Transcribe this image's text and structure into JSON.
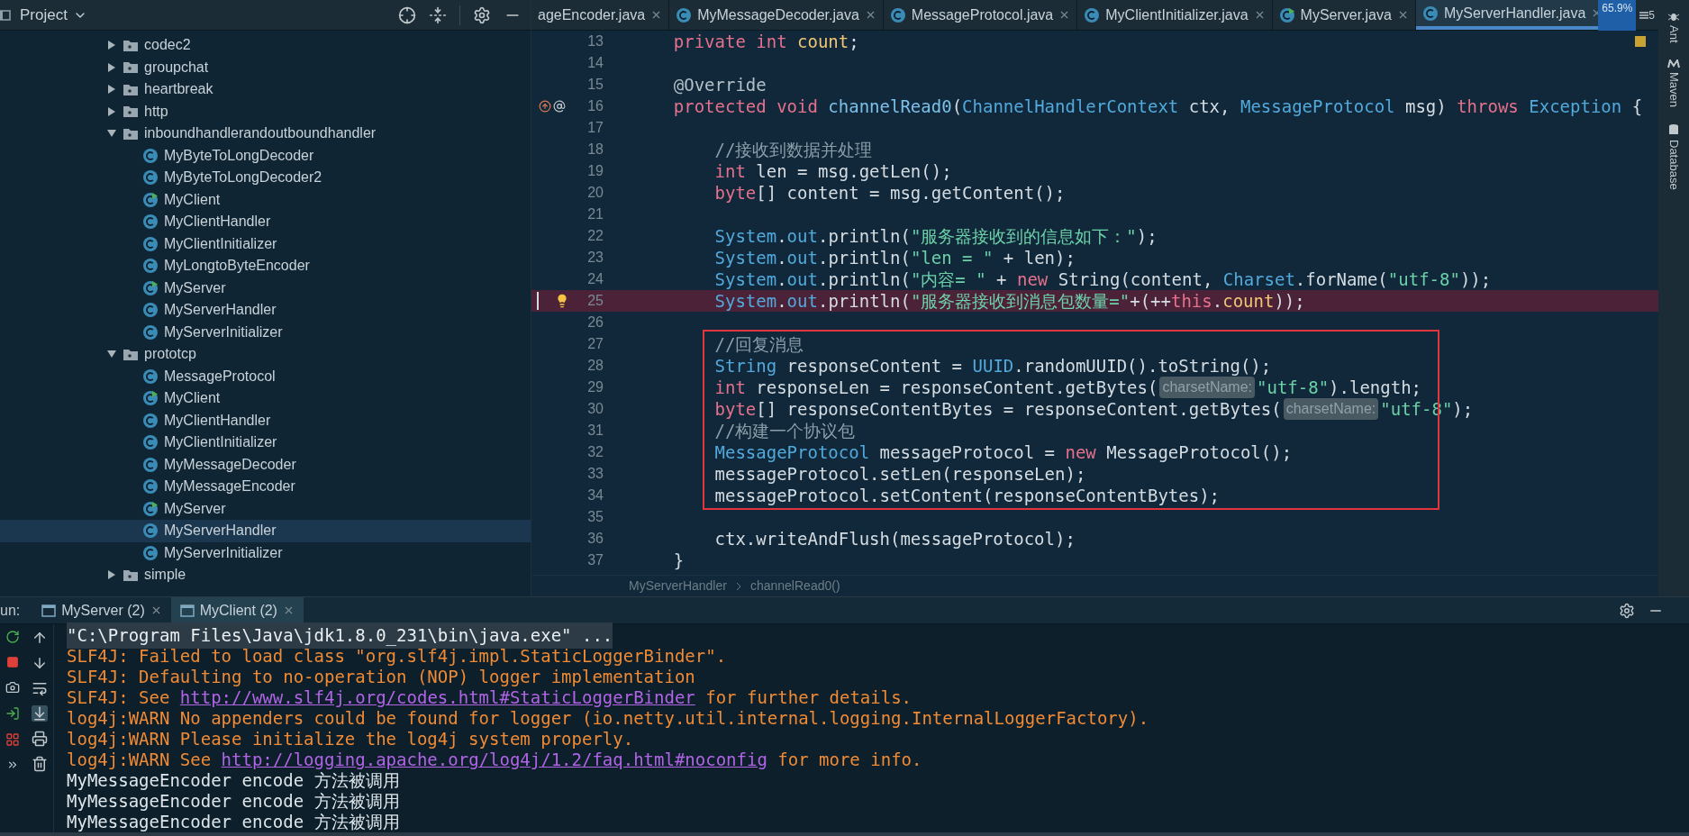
{
  "project_panel": {
    "title": "Project"
  },
  "tree": [
    {
      "label": "codec2",
      "kind": "folder",
      "expanded": false,
      "selected": false
    },
    {
      "label": "groupchat",
      "kind": "folder",
      "expanded": false,
      "selected": false
    },
    {
      "label": "heartbreak",
      "kind": "folder",
      "expanded": false,
      "selected": false
    },
    {
      "label": "http",
      "kind": "folder",
      "expanded": false,
      "selected": false
    },
    {
      "label": "inboundhandlerandoutboundhandler",
      "kind": "folder",
      "expanded": true,
      "selected": false,
      "children": [
        {
          "label": "MyByteToLongDecoder",
          "kind": "class",
          "runnable": false,
          "selected": false
        },
        {
          "label": "MyByteToLongDecoder2",
          "kind": "class",
          "runnable": false,
          "selected": false
        },
        {
          "label": "MyClient",
          "kind": "class",
          "runnable": true,
          "selected": false
        },
        {
          "label": "MyClientHandler",
          "kind": "class",
          "runnable": false,
          "selected": false
        },
        {
          "label": "MyClientInitializer",
          "kind": "class",
          "runnable": false,
          "selected": false
        },
        {
          "label": "MyLongtoByteEncoder",
          "kind": "class",
          "runnable": false,
          "selected": false
        },
        {
          "label": "MyServer",
          "kind": "class",
          "runnable": true,
          "selected": false
        },
        {
          "label": "MyServerHandler",
          "kind": "class",
          "runnable": false,
          "selected": false
        },
        {
          "label": "MyServerInitializer",
          "kind": "class",
          "runnable": false,
          "selected": false
        }
      ]
    },
    {
      "label": "prototcp",
      "kind": "folder",
      "expanded": true,
      "selected": false,
      "children": [
        {
          "label": "MessageProtocol",
          "kind": "class",
          "runnable": false,
          "selected": false
        },
        {
          "label": "MyClient",
          "kind": "class",
          "runnable": true,
          "selected": false
        },
        {
          "label": "MyClientHandler",
          "kind": "class",
          "runnable": false,
          "selected": false
        },
        {
          "label": "MyClientInitializer",
          "kind": "class",
          "runnable": false,
          "selected": false
        },
        {
          "label": "MyMessageDecoder",
          "kind": "class",
          "runnable": false,
          "selected": false
        },
        {
          "label": "MyMessageEncoder",
          "kind": "class",
          "runnable": false,
          "selected": false
        },
        {
          "label": "MyServer",
          "kind": "class",
          "runnable": true,
          "selected": false
        },
        {
          "label": "MyServerHandler",
          "kind": "class",
          "runnable": false,
          "selected": true
        },
        {
          "label": "MyServerInitializer",
          "kind": "class",
          "runnable": false,
          "selected": false
        }
      ]
    },
    {
      "label": "simple",
      "kind": "folder",
      "expanded": false,
      "selected": false
    }
  ],
  "editor_tabs": [
    {
      "label": "ageEncoder.java",
      "selected": false
    },
    {
      "label": "MyMessageDecoder.java",
      "runnable": false,
      "selected": false
    },
    {
      "label": "MessageProtocol.java",
      "runnable": false,
      "selected": false
    },
    {
      "label": "MyClientInitializer.java",
      "runnable": false,
      "selected": false
    },
    {
      "label": "MyServer.java",
      "runnable": true,
      "selected": false
    },
    {
      "label": "MyServerHandler.java",
      "runnable": false,
      "selected": true
    }
  ],
  "zoom_badge": "65.9%",
  "tab_count": "5",
  "editor": {
    "lines": [
      {
        "number": "13",
        "tokens": [
          {
            "kind": "kw",
            "text": "    private int "
          },
          {
            "kind": "field",
            "text": "count"
          },
          {
            "kind": "plain",
            "text": ";"
          }
        ]
      },
      {
        "number": "14"
      },
      {
        "number": "15",
        "tokens": [
          {
            "kind": "ann",
            "text": "    @Override"
          }
        ]
      },
      {
        "number": "16",
        "gutter": {
          "kind": "override"
        },
        "tokens": [
          {
            "kind": "kw",
            "text": "    protected void "
          },
          {
            "kind": "method",
            "text": "channelRead0"
          },
          {
            "kind": "plain",
            "text": "("
          },
          {
            "kind": "type",
            "text": "ChannelHandlerContext"
          },
          {
            "kind": "plain",
            "text": " ctx, "
          },
          {
            "kind": "type",
            "text": "MessageProtocol"
          },
          {
            "kind": "plain",
            "text": " msg) "
          },
          {
            "kind": "kw",
            "text": "throws "
          },
          {
            "kind": "type",
            "text": "Exception"
          },
          {
            "kind": "plain",
            "text": " {"
          }
        ]
      },
      {
        "number": "17"
      },
      {
        "number": "18",
        "tokens": [
          {
            "kind": "comment",
            "text": "        //接收到数据并处理"
          }
        ]
      },
      {
        "number": "19",
        "tokens": [
          {
            "kind": "kw",
            "text": "        int"
          },
          {
            "kind": "plain",
            "text": " len = msg.getLen();"
          }
        ]
      },
      {
        "number": "20",
        "tokens": [
          {
            "kind": "kw",
            "text": "        byte"
          },
          {
            "kind": "plain",
            "text": "[] content = msg.getContent();"
          }
        ]
      },
      {
        "number": "21"
      },
      {
        "number": "22",
        "tokens": [
          {
            "kind": "type",
            "text": "        System"
          },
          {
            "kind": "plain",
            "text": "."
          },
          {
            "kind": "field2",
            "text": "out"
          },
          {
            "kind": "plain",
            "text": ".println("
          },
          {
            "kind": "str",
            "text": "\"服务器接收到的信息如下：\""
          },
          {
            "kind": "plain",
            "text": ");"
          }
        ]
      },
      {
        "number": "23",
        "tokens": [
          {
            "kind": "type",
            "text": "        System"
          },
          {
            "kind": "plain",
            "text": "."
          },
          {
            "kind": "field2",
            "text": "out"
          },
          {
            "kind": "plain",
            "text": ".println("
          },
          {
            "kind": "str",
            "text": "\"len = \""
          },
          {
            "kind": "plain",
            "text": " + len);"
          }
        ]
      },
      {
        "number": "24",
        "tokens": [
          {
            "kind": "type",
            "text": "        System"
          },
          {
            "kind": "plain",
            "text": "."
          },
          {
            "kind": "field2",
            "text": "out"
          },
          {
            "kind": "plain",
            "text": ".println("
          },
          {
            "kind": "str",
            "text": "\"内容= \""
          },
          {
            "kind": "plain",
            "text": " + "
          },
          {
            "kind": "kw",
            "text": "new"
          },
          {
            "kind": "plain",
            "text": " String(content, "
          },
          {
            "kind": "type",
            "text": "Charset"
          },
          {
            "kind": "plain",
            "text": ".forName("
          },
          {
            "kind": "str",
            "text": "\"utf-8\""
          },
          {
            "kind": "plain",
            "text": "));"
          }
        ]
      },
      {
        "number": "25",
        "gutter": {
          "kind": "bulb"
        },
        "highlighted": true,
        "tokens": [
          {
            "kind": "type",
            "text": "        System"
          },
          {
            "kind": "plain",
            "text": "."
          },
          {
            "kind": "field2",
            "text": "out"
          },
          {
            "kind": "plain",
            "text": ".println("
          },
          {
            "kind": "str",
            "text": "\"服务器接收到消息包数量=\""
          },
          {
            "kind": "plain",
            "text": "+(++"
          },
          {
            "kind": "kw",
            "text": "this"
          },
          {
            "kind": "plain",
            "text": "."
          },
          {
            "kind": "field",
            "text": "count"
          },
          {
            "kind": "plain",
            "text": "));"
          }
        ]
      },
      {
        "number": "26"
      },
      {
        "number": "27",
        "framed": true,
        "tokens": [
          {
            "kind": "comment",
            "text": "        //回复消息"
          }
        ]
      },
      {
        "number": "28",
        "framed": true,
        "tokens": [
          {
            "kind": "type",
            "text": "        String"
          },
          {
            "kind": "plain",
            "text": " responseContent = "
          },
          {
            "kind": "type",
            "text": "UUID"
          },
          {
            "kind": "plain",
            "text": ".randomUUID().toString();"
          }
        ]
      },
      {
        "number": "29",
        "framed": true,
        "tokens": [
          {
            "kind": "kw",
            "text": "        int"
          },
          {
            "kind": "plain",
            "text": " responseLen = responseContent.getBytes("
          },
          {
            "kind": "hint",
            "text": "charsetName:"
          },
          {
            "kind": "str",
            "text": "\"utf-8\""
          },
          {
            "kind": "plain",
            "text": ").length;"
          }
        ]
      },
      {
        "number": "30",
        "framed": true,
        "tokens": [
          {
            "kind": "kw",
            "text": "        byte"
          },
          {
            "kind": "plain",
            "text": "[] responseContentBytes = responseContent.getBytes("
          },
          {
            "kind": "hint",
            "text": "charsetName:"
          },
          {
            "kind": "str",
            "text": "\"utf-8\""
          },
          {
            "kind": "plain",
            "text": ");"
          }
        ]
      },
      {
        "number": "31",
        "framed": true,
        "tokens": [
          {
            "kind": "comment",
            "text": "        //构建一个协议包"
          }
        ]
      },
      {
        "number": "32",
        "framed": true,
        "tokens": [
          {
            "kind": "type",
            "text": "        MessageProtocol"
          },
          {
            "kind": "plain",
            "text": " messageProtocol = "
          },
          {
            "kind": "kw",
            "text": "new"
          },
          {
            "kind": "plain",
            "text": " MessageProtocol();"
          }
        ]
      },
      {
        "number": "33",
        "framed": true,
        "tokens": [
          {
            "kind": "plain",
            "text": "        messageProtocol.setLen(responseLen);"
          }
        ]
      },
      {
        "number": "34",
        "framed": true,
        "tokens": [
          {
            "kind": "plain",
            "text": "        messageProtocol.setContent(responseContentBytes);"
          }
        ]
      },
      {
        "number": "35"
      },
      {
        "number": "36",
        "tokens": [
          {
            "kind": "plain",
            "text": "        ctx.writeAndFlush(messageProtocol);"
          }
        ]
      },
      {
        "number": "37",
        "tokens": [
          {
            "kind": "plain",
            "text": "    }"
          }
        ]
      }
    ]
  },
  "breadcrumb": [
    "MyServerHandler",
    "channelRead0()"
  ],
  "right_tools": [
    "Ant",
    "Maven",
    "Database"
  ],
  "run_panel": {
    "label": "un:",
    "tabs": [
      {
        "label": "MyServer (2)",
        "selected": false
      },
      {
        "label": "MyClient (2)",
        "selected": true
      }
    ]
  },
  "console": [
    {
      "kind": "command",
      "tokens": [
        {
          "kind": "text",
          "text": "\"C:\\Program Files\\Java\\jdk1.8.0_231\\bin\\java.exe\" ..."
        }
      ]
    },
    {
      "kind": "warning",
      "tokens": [
        {
          "kind": "text",
          "text": "SLF4J: Failed to load class \"org.slf4j.impl.StaticLoggerBinder\"."
        }
      ]
    },
    {
      "kind": "warning",
      "tokens": [
        {
          "kind": "text",
          "text": "SLF4J: Defaulting to no-operation (NOP) logger implementation"
        }
      ]
    },
    {
      "kind": "warning",
      "tokens": [
        {
          "kind": "text",
          "text": "SLF4J: See "
        },
        {
          "kind": "link",
          "text": "http://www.slf4j.org/codes.html#StaticLoggerBinder"
        },
        {
          "kind": "text",
          "text": " for further details."
        }
      ]
    },
    {
      "kind": "warning",
      "tokens": [
        {
          "kind": "text",
          "text": "log4j:WARN No appenders could be found for logger (io.netty.util.internal.logging.InternalLoggerFactory)."
        }
      ]
    },
    {
      "kind": "warning",
      "tokens": [
        {
          "kind": "text",
          "text": "log4j:WARN Please initialize the log4j system properly."
        }
      ]
    },
    {
      "kind": "warning",
      "tokens": [
        {
          "kind": "text",
          "text": "log4j:WARN See "
        },
        {
          "kind": "link",
          "text": "http://logging.apache.org/log4j/1.2/faq.html#noconfig"
        },
        {
          "kind": "text",
          "text": " for more info."
        }
      ]
    },
    {
      "kind": "output",
      "tokens": [
        {
          "kind": "text",
          "text": "MyMessageEncoder encode 方法被调用"
        }
      ]
    },
    {
      "kind": "output",
      "tokens": [
        {
          "kind": "text",
          "text": "MyMessageEncoder encode 方法被调用"
        }
      ]
    },
    {
      "kind": "output",
      "tokens": [
        {
          "kind": "text",
          "text": "MyMessageEncoder encode 方法被调用"
        }
      ]
    }
  ]
}
